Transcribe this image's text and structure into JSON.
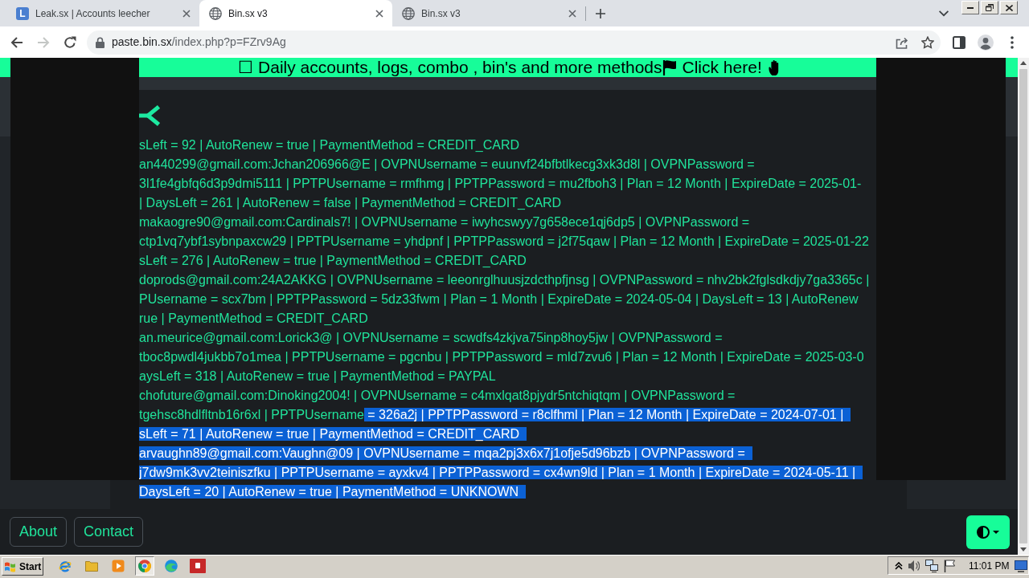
{
  "browser": {
    "tabs": [
      {
        "kind": "letter",
        "favicon": "L",
        "title": "Leak.sx | Accounts leecher",
        "selected": false
      },
      {
        "kind": "globe",
        "title": "Bin.sx v3",
        "selected": true
      },
      {
        "kind": "globe",
        "title": "Bin.sx v3",
        "selected": false
      }
    ],
    "nav": [
      {
        "kind": "back",
        "disabled": false
      },
      {
        "kind": "forward",
        "disabled": true
      },
      {
        "kind": "reload",
        "disabled": false
      }
    ],
    "address": {
      "host": "paste.bin.sx",
      "path": "/index.php?p=FZrv9Ag"
    }
  },
  "banner": {
    "text": "☐ Daily accounts, logs, combo , bin's and more methods",
    "link": "Click here!"
  },
  "paste": {
    "lines": [
      {
        "segments": [
          {
            "text": "sLeft = 92 | AutoRenew = true | PaymentMethod = CREDIT_CARD",
            "selected": false
          }
        ]
      },
      {
        "segments": [
          {
            "text": "an440299@gmail.com:Jchan206966@E | OVPNUsername = euunvf24bfbtlkecg3xk3d8l | OVPNPassword =",
            "selected": false
          }
        ]
      },
      {
        "segments": [
          {
            "text": "3l1fe4gbfq6d3p9dmi5111 | PPTPUsername = rmfhmg | PPTPPassword = mu2fboh3 | Plan = 12 Month | ExpireDate = 2025-01-",
            "selected": false
          }
        ]
      },
      {
        "segments": [
          {
            "text": "| DaysLeft = 261 | AutoRenew = false | PaymentMethod = CREDIT_CARD",
            "selected": false
          }
        ]
      },
      {
        "segments": [
          {
            "text": "makaogre90@gmail.com:Cardinals7! | OVPNUsername = iwyhcswyy7g658ece1qj6dp5 | OVPNPassword =",
            "selected": false
          }
        ]
      },
      {
        "segments": [
          {
            "text": "ctp1vq7ybf1sybnpaxcw29 | PPTPUsername = yhdpnf | PPTPPassword = j2f75qaw | Plan = 12 Month | ExpireDate = 2025-01-22",
            "selected": false
          }
        ]
      },
      {
        "segments": [
          {
            "text": "sLeft = 276 | AutoRenew = true | PaymentMethod = CREDIT_CARD",
            "selected": false
          }
        ]
      },
      {
        "segments": [
          {
            "text": "doprods@gmail.com:24A2AKKG | OVPNUsername = leeonrglhuusjzdcthpfjnsg | OVPNPassword = nhv2bk2fglsdkdjy7ga3365c |",
            "selected": false
          }
        ]
      },
      {
        "segments": [
          {
            "text": "PUsername = scx7bm | PPTPPassword = 5dz33fwm | Plan = 1 Month | ExpireDate = 2024-05-04 | DaysLeft = 13 | AutoRenew",
            "selected": false
          }
        ]
      },
      {
        "segments": [
          {
            "text": "rue | PaymentMethod = CREDIT_CARD",
            "selected": false
          }
        ]
      },
      {
        "segments": [
          {
            "text": "an.meurice@gmail.com:Lorick3@ | OVPNUsername = scwdfs4zkjva75inp8hoy5jw | OVPNPassword =",
            "selected": false
          }
        ]
      },
      {
        "segments": [
          {
            "text": "tboc8pwdl4jukbb7o1mea | PPTPUsername = pgcnbu | PPTPPassword = mld7zvu6 | Plan = 12 Month | ExpireDate = 2025-03-0",
            "selected": false
          }
        ]
      },
      {
        "segments": [
          {
            "text": "aysLeft = 318 | AutoRenew = true | PaymentMethod = PAYPAL",
            "selected": false
          }
        ]
      },
      {
        "segments": [
          {
            "text": "chofuture@gmail.com:Dinoking2004! | OVPNUsername = c4mxlqat8pjydr5ntchiqtqm | OVPNPassword =",
            "selected": false
          }
        ]
      },
      {
        "segments": [
          {
            "text": "tgehsc8hdlfltnb16r6xl | PPTPUsername",
            "selected": false
          },
          {
            "text": "= 326a2j | PPTPPassword = r8clfhml | Plan = 12 Month | ExpireDate = 2024-07-01 |",
            "selected": true
          }
        ]
      },
      {
        "segments": [
          {
            "text": "sLeft = 71 | AutoRenew = true | PaymentMethod = CREDIT_CARD",
            "selected": true
          }
        ]
      },
      {
        "segments": [
          {
            "text": "arvaughn89@gmail.com:Vaughn@09 | OVPNUsername = mqa2pj3x6x7j1ofje5d96bzb | OVPNPassword =",
            "selected": true
          }
        ]
      },
      {
        "segments": [
          {
            "text": "j7dw9mk3vv2teiniszfku | PPTPUsername = ayxkv4 | PPTPPassword = cx4wn9ld | Plan = 1 Month | ExpireDate = 2024-05-11 |",
            "selected": true
          }
        ]
      },
      {
        "segments": [
          {
            "text": "DaysLeft = 20 | AutoRenew = true | PaymentMethod = UNKNOWN",
            "selected": true
          }
        ]
      }
    ]
  },
  "footer": {
    "links": [
      "About",
      "Contact"
    ]
  },
  "taskbar": {
    "start": "Start",
    "apps": [
      {
        "kind": "ie",
        "selected": false
      },
      {
        "kind": "folder",
        "selected": false
      },
      {
        "kind": "media",
        "selected": false
      },
      {
        "kind": "chrome",
        "selected": true
      },
      {
        "kind": "edge",
        "selected": false
      },
      {
        "kind": "app",
        "selected": false
      }
    ],
    "clock": "11:01 PM"
  }
}
